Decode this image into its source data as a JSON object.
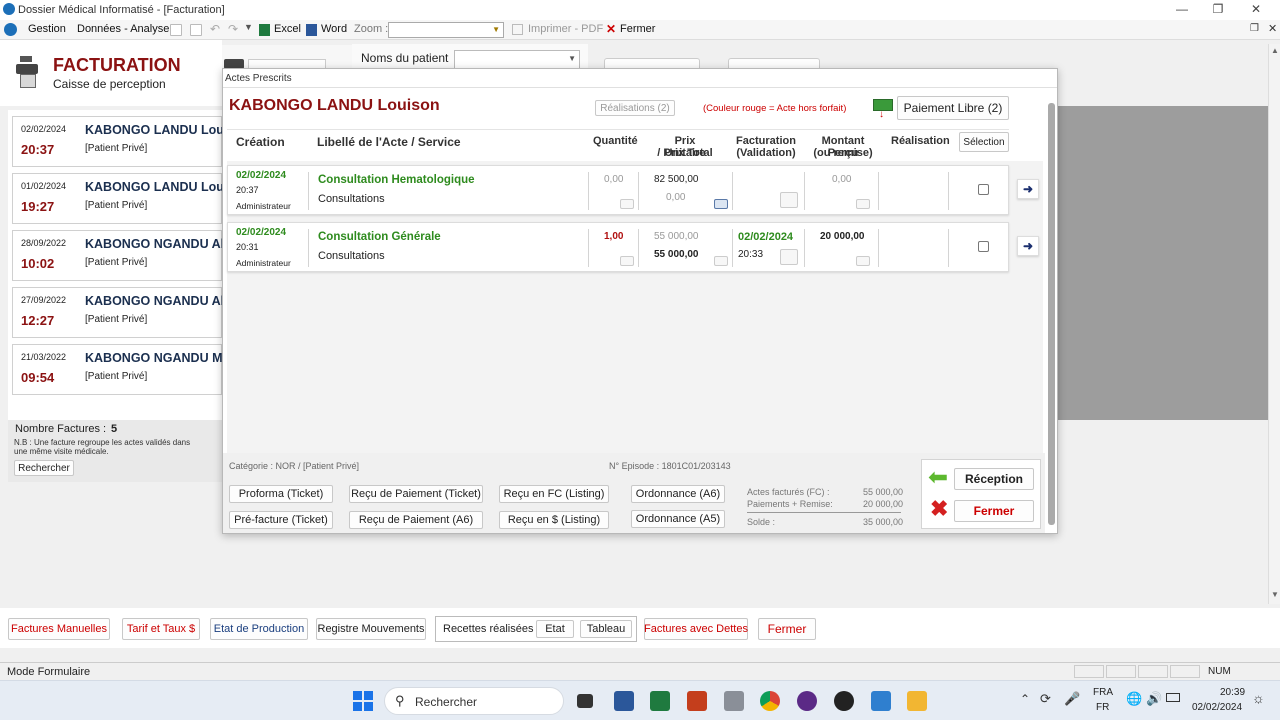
{
  "window": {
    "title": "Dossier Médical Informatisé - [Facturation]"
  },
  "menubar": {
    "gestion": "Gestion",
    "donnees": "Données - Analyse",
    "excel": "Excel",
    "word": "Word",
    "zoom_label": "Zoom :",
    "imprimer": "Imprimer - PDF",
    "fermer": "Fermer"
  },
  "header": {
    "title": "FACTURATION",
    "subtitle": "Caisse de perception",
    "patient_label": "Noms du patient"
  },
  "invoices": [
    {
      "date": "02/02/2024",
      "time": "20:37",
      "name": "KABONGO LANDU Louison",
      "type": "[Patient Privé]"
    },
    {
      "date": "01/02/2024",
      "time": "19:27",
      "name": "KABONGO LANDU Louison",
      "type": "[Patient Privé]"
    },
    {
      "date": "28/09/2022",
      "time": "10:02",
      "name": "KABONGO NGANDU Alain",
      "type": "[Patient Privé]"
    },
    {
      "date": "27/09/2022",
      "time": "12:27",
      "name": "KABONGO NGANDU Alain",
      "type": "[Patient Privé]"
    },
    {
      "date": "21/03/2022",
      "time": "09:54",
      "name": "KABONGO NGANDU Michel",
      "type": "[Patient Privé]"
    }
  ],
  "left_footer": {
    "count_label": "Nombre Factures :",
    "count": "5",
    "note": "N.B : Une facture regroupe les actes validés dans une même visite médicale.",
    "search": "Rechercher"
  },
  "dialog": {
    "caption": "Actes Prescrits",
    "patient_name": "KABONGO LANDU Louison",
    "realisations_btn": "Réalisations (2)",
    "color_note": "(Couleur rouge = Acte hors forfait)",
    "paiement_libre": "Paiement Libre (2)",
    "columns": {
      "creation": "Création",
      "libelle": "Libellé de l'Acte / Service",
      "quantite": "Quantité",
      "prix1": "Prix Unitaire",
      "prix2": "/ Prix Total",
      "fact1": "Facturation",
      "fact2": "(Validation)",
      "montant1": "Montant Perçu",
      "montant2": "(ou remise)",
      "realisation": "Réalisation",
      "selection": "Sélection"
    },
    "rows": [
      {
        "date": "02/02/2024",
        "time": "20:37",
        "user": "Administrateur",
        "act": "Consultation Hematologique",
        "category": "Consultations",
        "quantity": "0,00",
        "unit_price": "82 500,00",
        "total_price": "0,00",
        "fact_date": "",
        "fact_time": "",
        "montant": "0,00"
      },
      {
        "date": "02/02/2024",
        "time": "20:31",
        "user": "Administrateur",
        "act": "Consultation Générale",
        "category": "Consultations",
        "quantity": "1,00",
        "unit_price": "55 000,00",
        "total_price": "55 000,00",
        "fact_date": "02/02/2024",
        "fact_time": "20:33",
        "montant": "20 000,00"
      }
    ],
    "footer": {
      "categorie": "Catégorie : NOR / [Patient Privé]",
      "episode": "N° Episode : 1801C01/203143",
      "btn_proforma": "Proforma (Ticket)",
      "btn_prefacture": "Pré-facture (Ticket)",
      "btn_recu_ticket": "Reçu de Paiement (Ticket)",
      "btn_recu_a6": "Reçu de Paiement (A6)",
      "btn_recu_fc": "Reçu en FC (Listing)",
      "btn_recu_usd": "Reçu en $ (Listing)",
      "btn_ord_a6": "Ordonnance (A6)",
      "btn_ord_a5": "Ordonnance (A5)",
      "actes_label": "Actes facturés (FC) :",
      "actes_value": "55 000,00",
      "paiements_label": "Paiements + Remise:",
      "paiements_value": "20 000,00",
      "solde_label": "Solde :",
      "solde_value": "35 000,00",
      "reception": "Réception",
      "fermer": "Fermer"
    }
  },
  "bottom_bar": {
    "factures_manuelles": "Factures Manuelles",
    "tarif": "Tarif et Taux $",
    "etat_production": "Etat de Production",
    "registre": "Registre Mouvements",
    "recettes_label": "Recettes réalisées :",
    "etat": "Etat",
    "tableau": "Tableau",
    "factures_dettes": "Factures avec Dettes",
    "fermer": "Fermer"
  },
  "status": {
    "mode": "Mode Formulaire",
    "num": "NUM"
  },
  "taskbar": {
    "search": "Rechercher",
    "lang1": "FRA",
    "lang2": "FR",
    "time": "20:39",
    "date": "02/02/2024"
  },
  "colors": {
    "accent_red": "#8b1212",
    "green": "#2e8b1e",
    "navy": "#1b2f4f"
  }
}
